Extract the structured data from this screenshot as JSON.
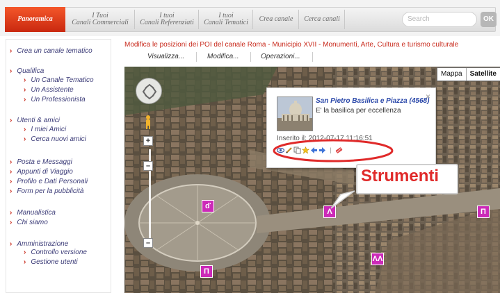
{
  "nav": {
    "tabs": [
      {
        "l1": "Panoramica",
        "l2": ""
      },
      {
        "l1": "I Tuoi",
        "l2": "Canali Commerciali"
      },
      {
        "l1": "I tuoi",
        "l2": "Canali Referenziati"
      },
      {
        "l1": "I tuoi",
        "l2": "Canali Tematici"
      },
      {
        "l1": "Crea canale",
        "l2": ""
      },
      {
        "l1": "Cerca canali",
        "l2": ""
      }
    ],
    "search_placeholder": "Search",
    "ok_label": "OK"
  },
  "sidebar": {
    "create_theme": "Crea un canale tematico",
    "qualifica": "Qualifica",
    "qualifica_items": [
      "Un Canale Tematico",
      "Un Assistente",
      "Un Professionista"
    ],
    "utenti": "Utenti & amici",
    "utenti_items": [
      "I miei Amici",
      "Cerca nuovi amici"
    ],
    "misc": [
      "Posta e Messaggi",
      "Appunti di Viaggio",
      "Profilo e Dati Personali",
      "Form per la pubblicità"
    ],
    "manualistica": "Manualistica",
    "chi_siamo": "Chi siamo",
    "amministrazione": "Amministrazione",
    "admin_items": [
      "Controllo versione",
      "Gestione utenti"
    ]
  },
  "main": {
    "title": "Modifica le posizioni dei POI del canale Roma - Municipio XVII - Monumenti, Arte, Cultura e turismo culturale",
    "menus": [
      "Visualizza...",
      "Modifica...",
      "Operazioni..."
    ]
  },
  "map": {
    "types": [
      "Mappa",
      "Satellite"
    ],
    "active_type": "Satellite",
    "popup": {
      "title": "San Pietro Basilica e Piazza (4568)",
      "description": "E' la basilica per eccellenza",
      "inserted": "Inserito il: 2012-07-17 11:16:51",
      "tool_icons": [
        "eye-icon",
        "pencil-icon",
        "copy-icon",
        "star-icon",
        "arrow-left-icon",
        "arrow-right-icon",
        "delete-icon"
      ]
    },
    "annotation": "Strumenti"
  },
  "colors": {
    "accent": "#c8281a",
    "tab_active": "#e3421d",
    "link": "#3c3c78",
    "annotation_red": "#e02a2a",
    "poi_marker": "#cc2ab8"
  }
}
